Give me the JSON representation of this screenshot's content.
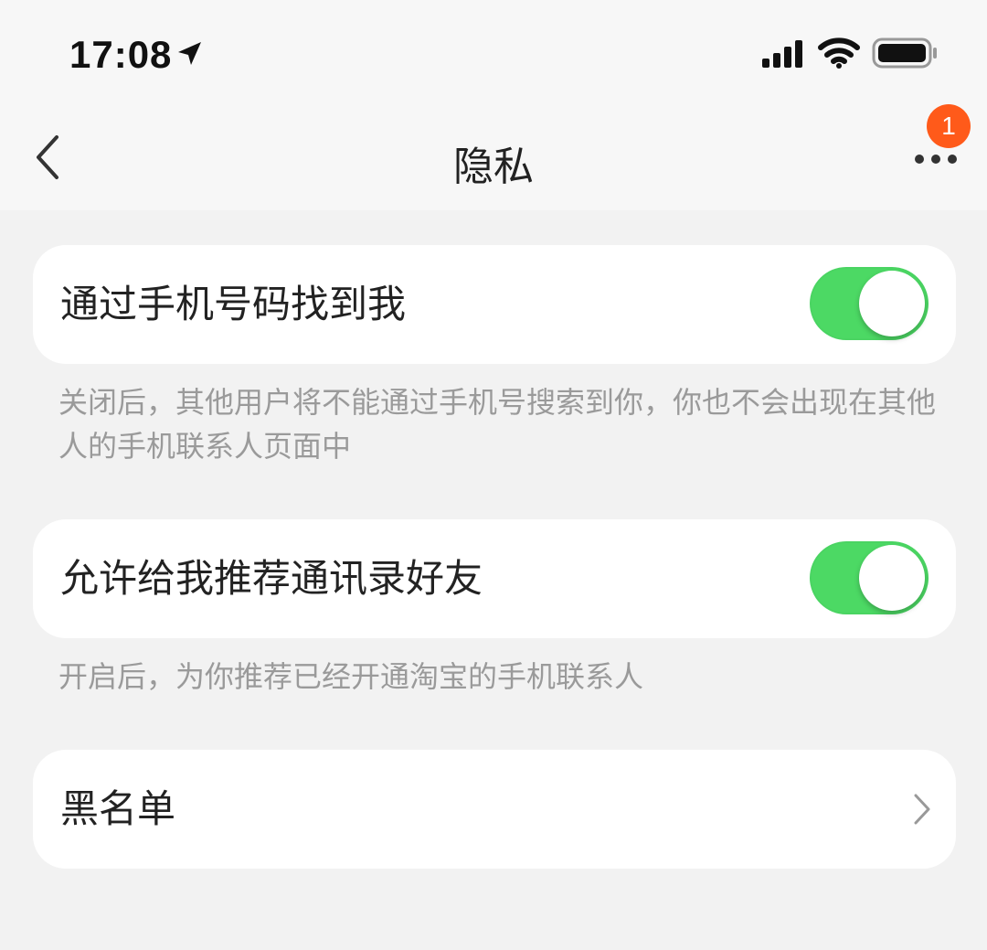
{
  "status_bar": {
    "time": "17:08",
    "icons": [
      "location-arrow-icon",
      "signal-icon",
      "wifi-icon",
      "battery-icon"
    ]
  },
  "nav": {
    "title": "隐私",
    "back_icon": "chevron-left-icon",
    "more_icon": "more-dots-icon",
    "badge_count": "1",
    "badge_color": "#ff5a1a"
  },
  "settings": {
    "find_by_phone": {
      "label": "通过手机号码找到我",
      "enabled": true,
      "description": "关闭后，其他用户将不能通过手机号搜索到你，你也不会出现在其他人的手机联系人页面中"
    },
    "recommend_contacts": {
      "label": "允许给我推荐通讯录好友",
      "enabled": true,
      "description": "开启后，为你推荐已经开通淘宝的手机联系人"
    },
    "blacklist": {
      "label": "黑名单",
      "icon": "chevron-right-icon"
    }
  },
  "colors": {
    "toggle_on": "#4cd964",
    "background": "#f2f2f2",
    "card": "#ffffff"
  }
}
